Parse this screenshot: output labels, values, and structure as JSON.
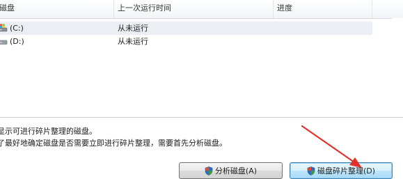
{
  "columns": {
    "disk": "磁盘",
    "last_run": "上一次运行时间",
    "progress": "进度"
  },
  "disks": [
    {
      "name": "(C:)",
      "last_run": "从未运行",
      "icon": "system-drive-icon",
      "selected": true
    },
    {
      "name": "(D:)",
      "last_run": "从未运行",
      "icon": "hard-drive-icon",
      "selected": false
    }
  ],
  "info": {
    "line1": "显示可进行碎片整理的磁盘。",
    "line2": "了最好地确定磁盘是否需要立即进行碎片整理，需要首先分析磁盘。"
  },
  "buttons": {
    "analyze": "分析磁盘(A)",
    "defragment": "磁盘碎片整理(D)"
  },
  "colors": {
    "annotation_arrow": "#e0322b",
    "selection": "#ebeef2"
  }
}
